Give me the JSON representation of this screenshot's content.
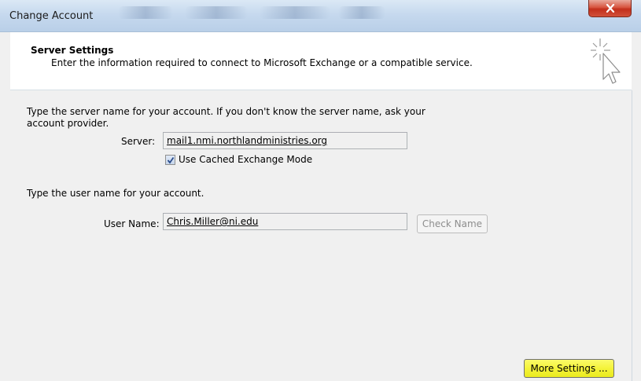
{
  "window": {
    "title": "Change Account"
  },
  "header": {
    "title": "Server Settings",
    "description": "Enter the information required to connect to Microsoft Exchange or a compatible service."
  },
  "server_section": {
    "instruction_line1": "Type the server name for your account. If you don't know the server name, ask your",
    "instruction_line2": "account provider.",
    "server_label": "Server:",
    "server_value": "mail1.nmi.northlandministries.org",
    "cached_mode_label": "Use Cached Exchange Mode",
    "cached_mode_checked": true
  },
  "user_section": {
    "instruction": "Type the user name for your account.",
    "user_label": "User Name:",
    "user_value": "Chris.Miller@ni.edu",
    "check_name_label": "Check Name"
  },
  "footer": {
    "more_settings_label": "More Settings ..."
  },
  "colors": {
    "highlight": "#f4f33a",
    "close_button": "#c2301c"
  }
}
